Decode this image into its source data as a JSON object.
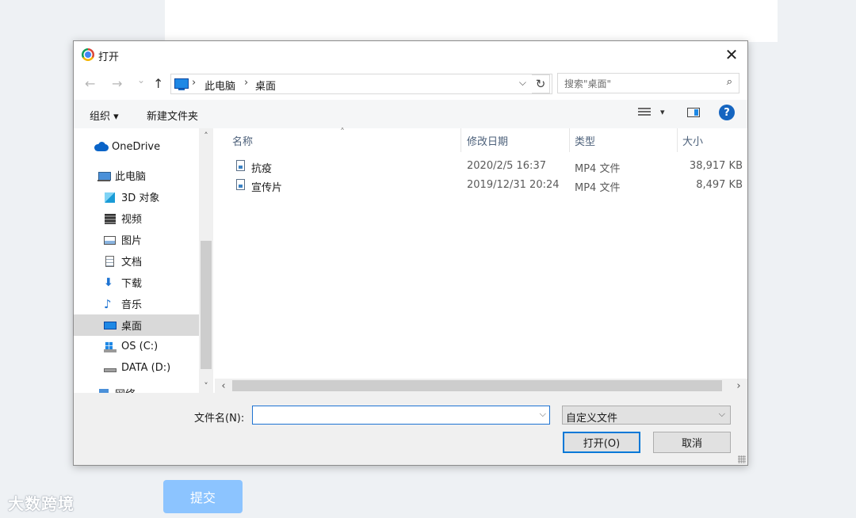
{
  "dialog": {
    "title": "打开",
    "close_icon": "✕"
  },
  "nav": {
    "back_icon": "←",
    "forward_icon": "→",
    "history_icon": "⌄",
    "up_icon": "↑",
    "breadcrumb": [
      "此电脑",
      "桌面"
    ],
    "refresh_icon": "↻",
    "search_placeholder": "搜索\"桌面\""
  },
  "toolbar": {
    "organize_label": "组织 ▾",
    "new_folder_label": "新建文件夹",
    "help_label": "?"
  },
  "sidebar": {
    "items": [
      {
        "label": "OneDrive",
        "icon": "cloud-icon"
      },
      {
        "label": "此电脑",
        "icon": "computer-icon"
      },
      {
        "label": "3D 对象",
        "icon": "cube-icon"
      },
      {
        "label": "视频",
        "icon": "video-icon"
      },
      {
        "label": "图片",
        "icon": "picture-icon"
      },
      {
        "label": "文档",
        "icon": "document-icon"
      },
      {
        "label": "下载",
        "icon": "download-icon"
      },
      {
        "label": "音乐",
        "icon": "music-icon"
      },
      {
        "label": "桌面",
        "icon": "desktop-icon"
      },
      {
        "label": "OS (C:)",
        "icon": "drive-c-icon"
      },
      {
        "label": "DATA (D:)",
        "icon": "drive-d-icon"
      },
      {
        "label": "网络",
        "icon": "network-icon"
      }
    ],
    "selected": "桌面"
  },
  "files": {
    "columns": [
      "名称",
      "修改日期",
      "类型",
      "大小"
    ],
    "rows": [
      {
        "name": "抗疫",
        "date": "2020/2/5 16:37",
        "type": "MP4 文件",
        "size": "38,917 KB"
      },
      {
        "name": "宣传片",
        "date": "2019/12/31 20:24",
        "type": "MP4 文件",
        "size": "8,497 KB"
      }
    ]
  },
  "footer": {
    "filename_label": "文件名(N):",
    "filename_value": "",
    "filetype_value": "自定义文件",
    "open_label": "打开(O)",
    "cancel_label": "取消"
  },
  "page": {
    "submit_label": "提交",
    "watermark": "大数跨境"
  }
}
